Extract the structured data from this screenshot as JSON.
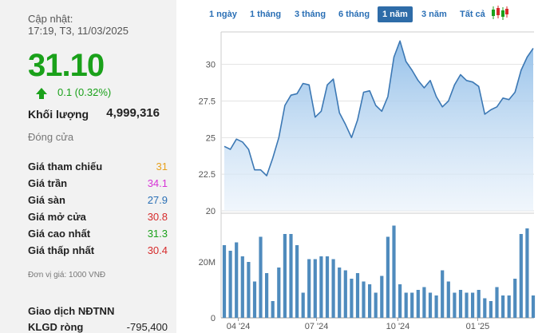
{
  "info": {
    "updated_label": "Cập nhật:",
    "updated_time": "17:19, T3, 11/03/2025",
    "price": "31.10",
    "change": "0.1 (0.32%)",
    "volume_label": "Khối lượng",
    "volume_value": "4,999,316",
    "status": "Đóng cửa",
    "stats": [
      {
        "label": "Giá tham chiếu",
        "value": "31",
        "color": "#e8a11d"
      },
      {
        "label": "Giá trần",
        "value": "34.1",
        "color": "#d633d6"
      },
      {
        "label": "Giá sàn",
        "value": "27.9",
        "color": "#2a6fb5"
      },
      {
        "label": "Giá mở cửa",
        "value": "30.8",
        "color": "#d62b2b"
      },
      {
        "label": "Giá cao nhất",
        "value": "31.3",
        "color": "#1aa11a"
      },
      {
        "label": "Giá thấp nhất",
        "value": "30.4",
        "color": "#d62b2b"
      }
    ],
    "unit_note": "Đơn vị giá: 1000 VNĐ",
    "foreign_title": "Giao dịch NĐTNN",
    "klgd_label": "KLGD ròng",
    "klgd_value": "-795,400"
  },
  "colors": {
    "up": "#1aa11a",
    "line": "#3c78b4",
    "area_top": "#8fbde8",
    "area_bottom": "#e6f0fa",
    "bar": "#4f8bbd",
    "active_tab": "#2e6ca8"
  },
  "tabs": [
    "1 ngày",
    "1 tháng",
    "3 tháng",
    "6 tháng",
    "1 năm",
    "3 năm",
    "Tất cả"
  ],
  "active_tab": "1 năm",
  "candle_icon": "candlestick-chart-icon",
  "chart_data": [
    {
      "type": "area",
      "x_ticks": [
        "04 '24",
        "07 '24",
        "10 '24",
        "01 '25"
      ],
      "y_ticks": [
        "20",
        "22.5",
        "25",
        "27.5",
        "30"
      ],
      "ylim": [
        20,
        32
      ],
      "grid": true,
      "values": [
        24.4,
        24.2,
        24.9,
        24.7,
        24.2,
        22.8,
        22.8,
        22.4,
        23.6,
        25.0,
        27.2,
        27.9,
        28.0,
        28.7,
        28.6,
        26.4,
        26.8,
        28.6,
        29.0,
        26.7,
        25.9,
        25.0,
        26.2,
        28.1,
        28.2,
        27.2,
        26.8,
        27.8,
        30.5,
        31.6,
        30.2,
        29.6,
        28.9,
        28.4,
        28.9,
        27.8,
        27.1,
        27.5,
        28.6,
        29.3,
        28.9,
        28.8,
        28.5,
        26.6,
        26.9,
        27.1,
        27.7,
        27.6,
        28.1,
        29.6,
        30.5,
        31.1
      ]
    },
    {
      "type": "bar",
      "y_ticks": [
        "0",
        "20M"
      ],
      "ylim": [
        0,
        36
      ],
      "values": [
        26,
        24,
        27,
        22,
        20,
        13,
        29,
        16,
        6,
        18,
        30,
        30,
        26,
        9,
        21,
        21,
        22,
        22,
        21,
        18,
        17,
        14,
        16,
        13,
        12,
        9,
        15,
        29,
        33,
        12,
        9,
        9,
        10,
        11,
        9,
        8,
        17,
        13,
        9,
        10,
        9,
        9,
        10,
        7,
        6,
        11,
        8,
        8,
        14,
        30,
        32,
        8
      ]
    }
  ]
}
